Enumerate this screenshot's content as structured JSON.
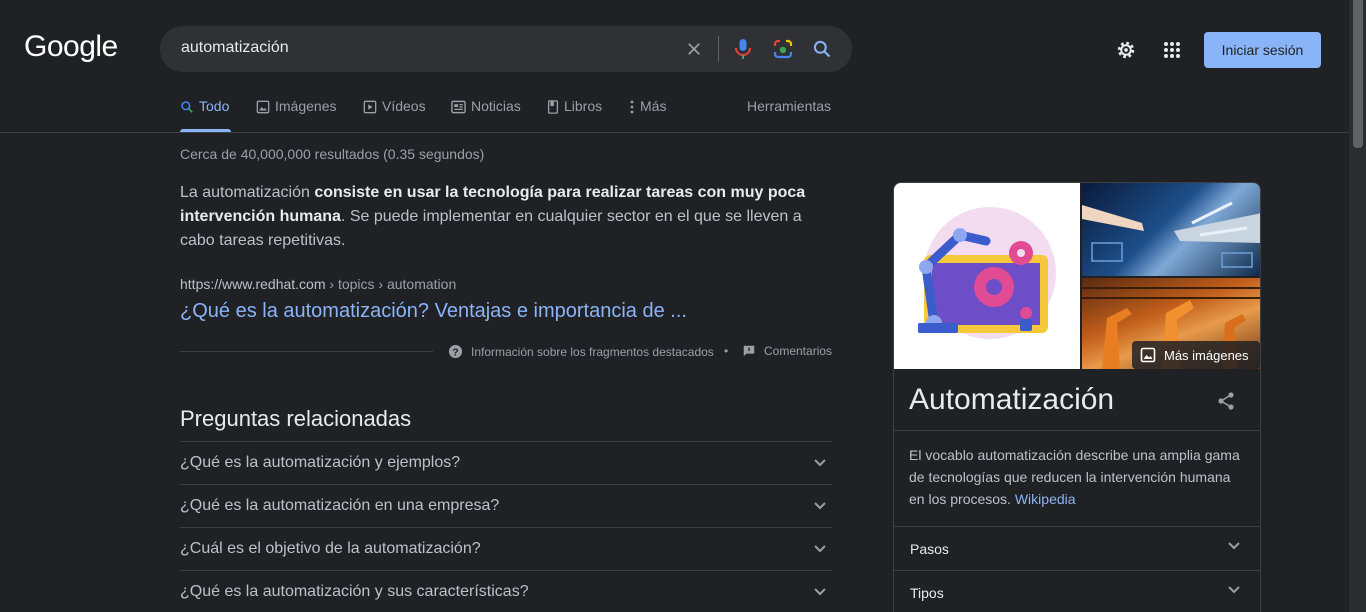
{
  "header": {
    "logo": "Google",
    "search_query": "automatización",
    "signin_label": "Iniciar sesión",
    "icons": [
      "clear-icon",
      "mic-icon",
      "lens-icon",
      "search-icon",
      "settings-icon",
      "apps-icon"
    ]
  },
  "tabs": [
    {
      "label": "Todo",
      "icon": "search-icon",
      "active": true
    },
    {
      "label": "Imágenes",
      "icon": "image-icon"
    },
    {
      "label": "Vídeos",
      "icon": "video-icon"
    },
    {
      "label": "Noticias",
      "icon": "news-icon"
    },
    {
      "label": "Libros",
      "icon": "book-icon"
    },
    {
      "label": "Más",
      "icon": "more-vert-icon"
    },
    {
      "label": "Herramientas"
    }
  ],
  "stats": "Cerca de 40,000,000 resultados (0.35 segundos)",
  "featured_snippet": {
    "text_before": "La automatización ",
    "text_bold": "consiste en usar la tecnología para realizar tareas con muy poca intervención humana",
    "text_after": ". Se puede implementar en cualquier sector en el que se lleven a cabo tareas repetitivas.",
    "cite_domain": "https://www.redhat.com",
    "cite_path": " › topics › automation",
    "title": "¿Qué es la automatización? Ventajas e importancia de ...",
    "about_label": "Información sobre los fragmentos destacados",
    "bullet": "•",
    "feedback_label": "Comentarios"
  },
  "related_questions": {
    "title": "Preguntas relacionadas",
    "items": [
      "¿Qué es la automatización y ejemplos?",
      "¿Qué es la automatización en una empresa?",
      "¿Cuál es el objetivo de la automatización?",
      "¿Qué es la automatización y sus características?"
    ]
  },
  "knowledge_panel": {
    "more_images_label": "Más imágenes",
    "title": "Automatización",
    "description": "El vocablo automatización describe una amplia gama de tecnologías que reducen la intervención humana en los procesos.",
    "source_link": "Wikipedia",
    "rows": [
      "Pasos",
      "Tipos"
    ]
  },
  "colors": {
    "background": "#202124",
    "link": "#8ab4f8",
    "text": "#bdc1c6",
    "heading": "#e8eaed",
    "accent_button": "#8ab4f8"
  }
}
